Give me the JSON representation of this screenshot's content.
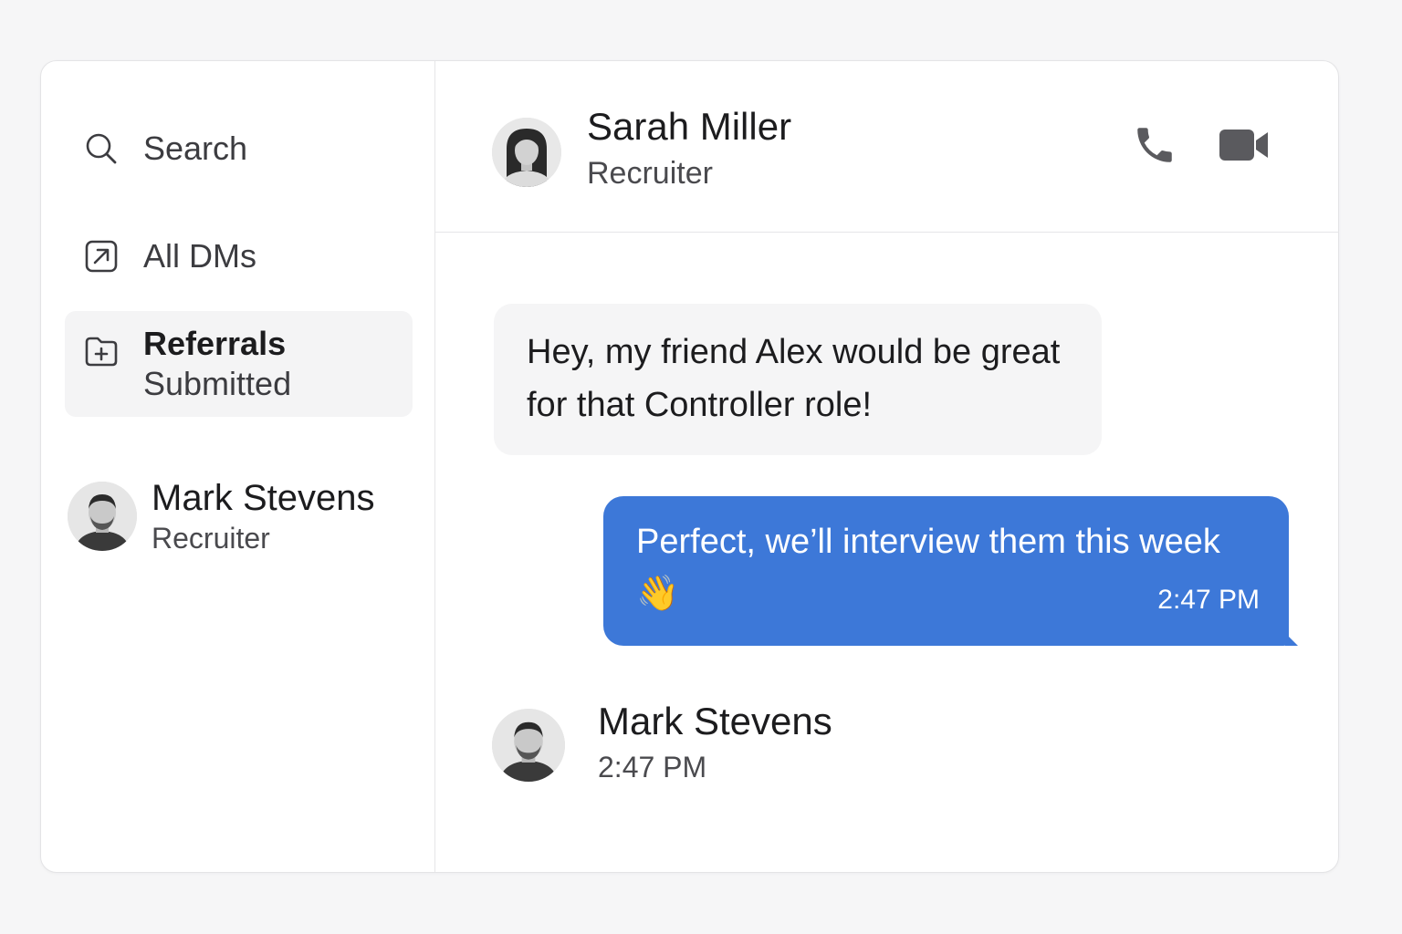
{
  "sidebar": {
    "search": {
      "label": "Search",
      "icon": "search-icon"
    },
    "all_dms": {
      "label": "All DMs",
      "icon": "external-link-icon"
    },
    "referrals": {
      "title": "Referrals",
      "subtitle": "Submitted",
      "icon": "folder-plus-icon",
      "selected": true
    },
    "contacts": [
      {
        "name": "Mark Stevens",
        "role": "Recruiter"
      }
    ]
  },
  "chat": {
    "header": {
      "name": "Sarah Miller",
      "role": "Recruiter",
      "actions": [
        "phone-icon",
        "video-camera-icon"
      ]
    },
    "messages": [
      {
        "direction": "incoming",
        "text": "Hey, my friend Alex would be great for that Controller role!"
      },
      {
        "direction": "outgoing",
        "text": "Perfect, we’ll interview them this week",
        "emoji": "👋",
        "time": "2:47 PM"
      }
    ],
    "last_sender": {
      "name": "Mark Stevens",
      "time": "2:47 PM"
    }
  },
  "colors": {
    "accent": "#3d78d8",
    "bubble_incoming": "#f5f5f6",
    "selected_bg": "#f4f4f5",
    "icon_gray": "#5a5a5e"
  }
}
